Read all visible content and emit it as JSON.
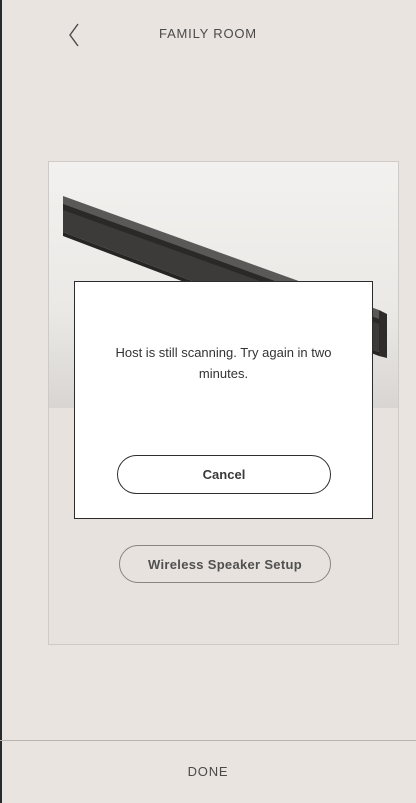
{
  "header": {
    "title": "FAMILY ROOM",
    "back_icon": "chevron-left-icon"
  },
  "card": {
    "product_image": "soundbar-speaker",
    "setup_button_label": "Wireless Speaker Setup"
  },
  "dialog": {
    "message": "Host is still scanning. Try again in two minutes.",
    "cancel_label": "Cancel"
  },
  "footer": {
    "done_label": "DONE"
  },
  "colors": {
    "background": "#e9e4df",
    "dialog_bg": "#ffffff",
    "text": "#4a4a4a"
  }
}
